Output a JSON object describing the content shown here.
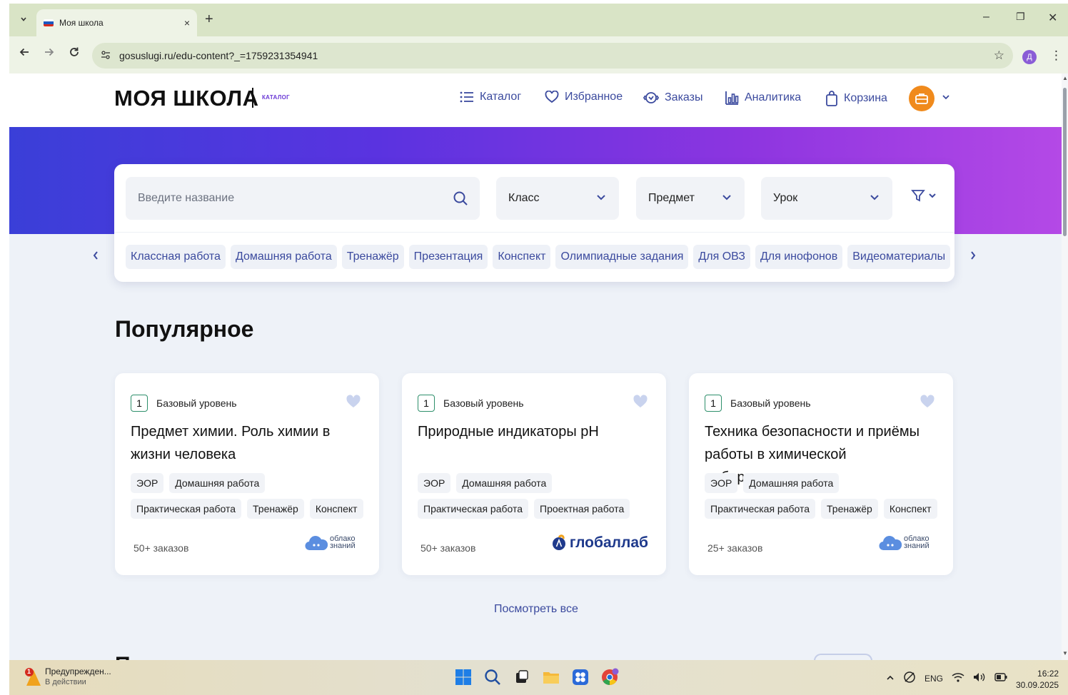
{
  "browser": {
    "tab_title": "Моя школа",
    "tab_close": "×",
    "new_tab": "+",
    "url": "gosuslugi.ru/edu-content?_=1759231354941",
    "profile_initial": "Д",
    "window_minimize": "–",
    "window_restore": "❐",
    "window_close": "✕"
  },
  "header": {
    "logo": "МОЯ ШКОЛА",
    "logo_badge": "КАТАЛОГ",
    "nav": [
      {
        "label": "Каталог",
        "icon": "list-icon"
      },
      {
        "label": "Избранное",
        "icon": "heart-icon"
      },
      {
        "label": "Заказы",
        "icon": "orders-icon"
      },
      {
        "label": "Аналитика",
        "icon": "analytics-icon"
      },
      {
        "label": "Корзина",
        "icon": "bag-icon"
      }
    ],
    "accent_color": "#3b4a9e",
    "profile_color": "#f08a1c"
  },
  "search": {
    "placeholder": "Введите название",
    "dropdowns": [
      "Класс",
      "Предмет",
      "Урок"
    ]
  },
  "chips": [
    "Классная работа",
    "Домашняя работа",
    "Тренажёр",
    "Презентация",
    "Конспект",
    "Олимпиадные задания",
    "Для ОВЗ",
    "Для инофонов",
    "Видеоматериалы"
  ],
  "section": {
    "title": "Популярное",
    "see_all": "Посмотреть все",
    "next_title_peek": "П"
  },
  "cards": [
    {
      "grade": "1",
      "level": "Базовый уровень",
      "title": "Предмет химии. Роль химии в жизни человека",
      "tags": [
        "ЭОР",
        "Домашняя работа",
        "Практическая работа",
        "Тренажёр",
        "Конспект"
      ],
      "orders": "50+ заказов",
      "vendor": "облако знаний",
      "vendor_type": "oblako"
    },
    {
      "grade": "1",
      "level": "Базовый уровень",
      "title": "Природные индикаторы pH",
      "tags": [
        "ЭОР",
        "Домашняя работа",
        "Практическая работа",
        "Проектная работа"
      ],
      "orders": "50+ заказов",
      "vendor": "глобаллаб",
      "vendor_type": "globallab"
    },
    {
      "grade": "1",
      "level": "Базовый уровень",
      "title": "Техника безопасности и приёмы работы в химической лаборатории",
      "tags": [
        "ЭОР",
        "Домашняя работа",
        "Практическая работа",
        "Тренажёр",
        "Конспект"
      ],
      "orders": "25+ заказов",
      "vendor": "облако знаний",
      "vendor_type": "oblako"
    }
  ],
  "taskbar": {
    "notification_title": "Предупрежден...",
    "notification_sub": "В действии",
    "notification_count": "1",
    "lang": "ENG",
    "time": "16:22",
    "date": "30.09.2025"
  }
}
